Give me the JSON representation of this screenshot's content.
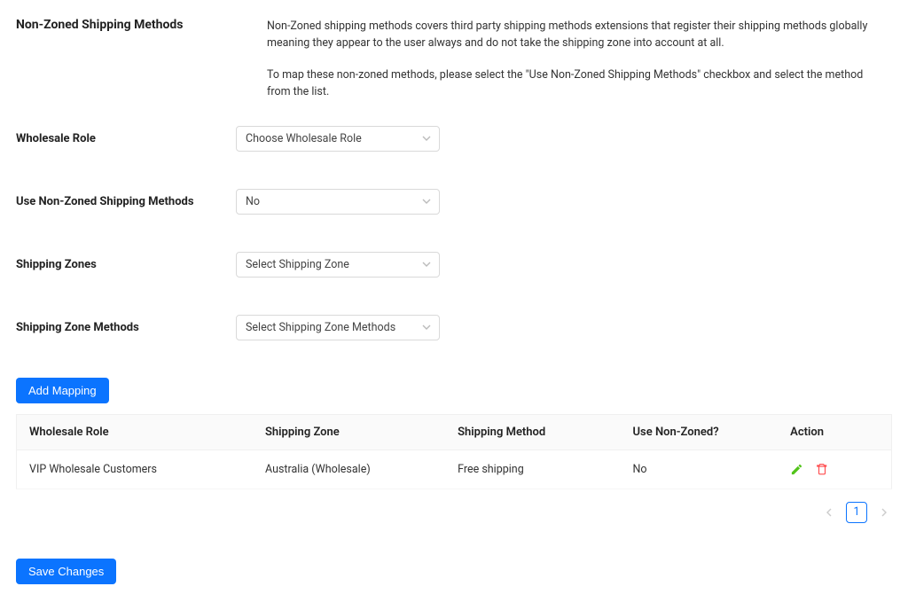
{
  "header": {
    "title": "Non-Zoned Shipping Methods",
    "desc1": "Non-Zoned shipping methods covers third party shipping methods extensions that register their shipping methods globally meaning they appear to the user always and do not take the shipping zone into account at all.",
    "desc2": "To map these non-zoned methods, please select the \"Use Non-Zoned Shipping Methods\" checkbox and select the method from the list."
  },
  "fields": {
    "wholesale_role": {
      "label": "Wholesale Role",
      "value": "Choose Wholesale Role"
    },
    "use_nonzoned": {
      "label": "Use Non-Zoned Shipping Methods",
      "value": "No"
    },
    "shipping_zones": {
      "label": "Shipping Zones",
      "value": "Select Shipping Zone"
    },
    "zone_methods": {
      "label": "Shipping Zone Methods",
      "value": "Select Shipping Zone Methods"
    }
  },
  "buttons": {
    "add_mapping": "Add Mapping",
    "save": "Save Changes"
  },
  "table": {
    "headers": {
      "role": "Wholesale Role",
      "zone": "Shipping Zone",
      "method": "Shipping Method",
      "nonzoned": "Use Non-Zoned?",
      "action": "Action"
    },
    "rows": [
      {
        "role": "VIP Wholesale Customers",
        "zone": "Australia (Wholesale)",
        "method": "Free shipping",
        "nonzoned": "No"
      }
    ]
  },
  "pagination": {
    "current": "1"
  }
}
